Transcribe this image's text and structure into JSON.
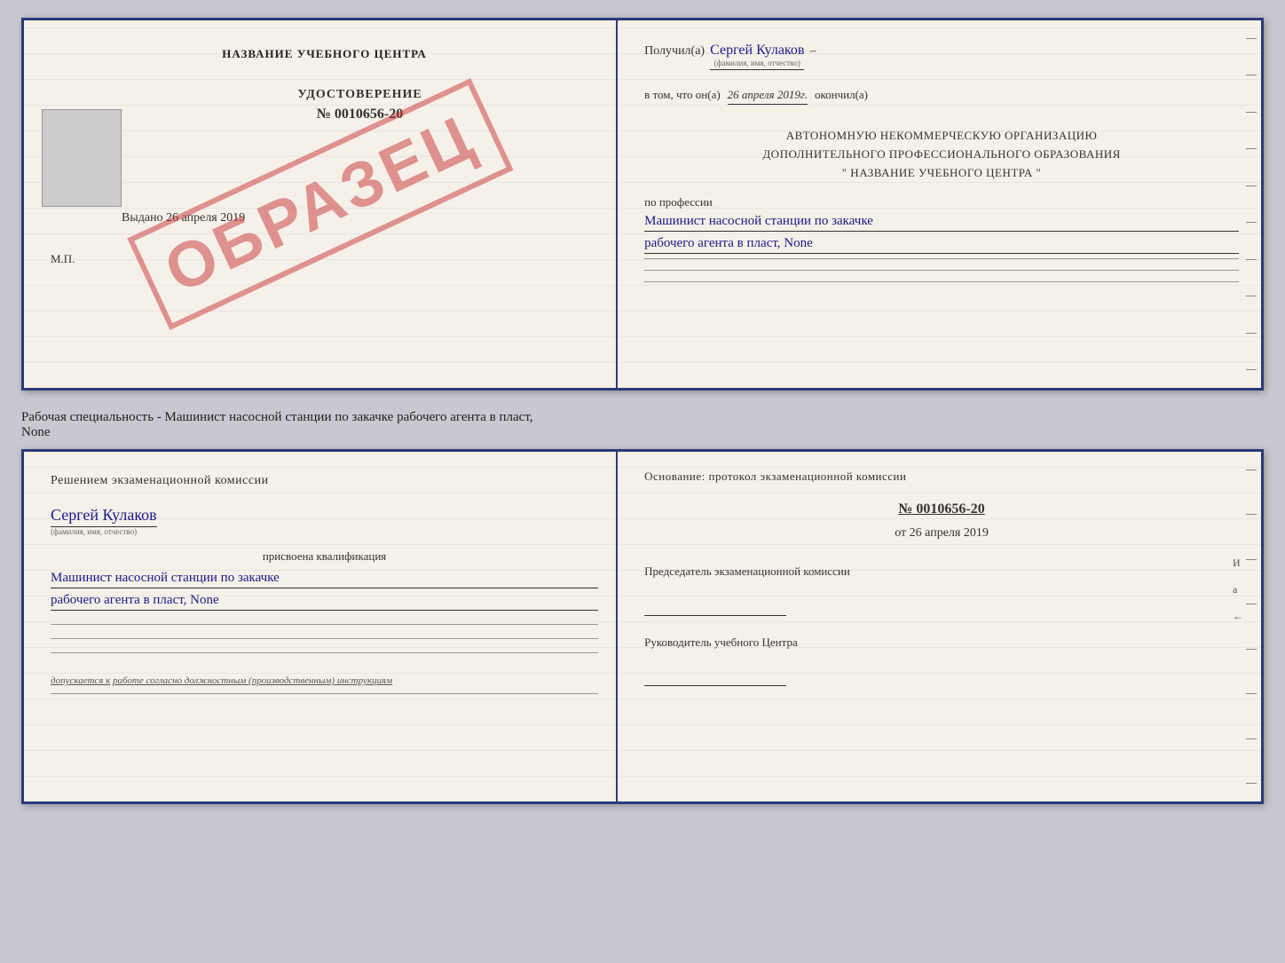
{
  "top_doc": {
    "left": {
      "center_title": "НАЗВАНИЕ УЧЕБНОГО ЦЕНТРА",
      "photo_alt": "фото",
      "stamp_text": "ОБРАЗЕЦ",
      "udostoverenie_label": "УДОСТОВЕРЕНИЕ",
      "doc_number": "№ 0010656-20",
      "vydano_label": "Выдано",
      "vydano_date": "26 апреля 2019",
      "mp_label": "М.П."
    },
    "right": {
      "poluchil_label": "Получил(а)",
      "poluchil_name": "Сергей Кулаков",
      "name_hint": "(фамилия, имя, отчество)",
      "dash": "–",
      "vtom_label": "в том, что он(а)",
      "vtom_date": "26 апреля 2019г.",
      "okonchil_label": "окончил(а)",
      "org_line1": "АВТОНОМНУЮ НЕКОММЕРЧЕСКУЮ ОРГАНИЗАЦИЮ",
      "org_line2": "ДОПОЛНИТЕЛЬНОГО ПРОФЕССИОНАЛЬНОГО ОБРАЗОВАНИЯ",
      "org_line3": "\" НАЗВАНИЕ УЧЕБНОГО ЦЕНТРА \"",
      "po_professii": "по профессии",
      "profession_line1": "Машинист насосной станции по закачке",
      "profession_line2": "рабочего агента в пласт, None"
    }
  },
  "middle": {
    "text": "Рабочая специальность - Машинист насосной станции по закачке рабочего агента в пласт,",
    "text2": "None"
  },
  "bottom_doc": {
    "left": {
      "resheniem_text": "Решением экзаменационной комиссии",
      "name": "Сергей Кулаков",
      "name_hint": "(фамилия, имя, отчество)",
      "prisvoena": "присвоена квалификация",
      "qualification_line1": "Машинист насосной станции по закачке",
      "qualification_line2": "рабочего агента в пласт, None",
      "dopuskaetsya_label": "допускается к",
      "dopuskaetsya_text": "работе согласно должностным (производственным) инструкциям"
    },
    "right": {
      "osnovanie_label": "Основание: протокол экзаменационной комиссии",
      "protocol_number": "№ 0010656-20",
      "ot_label": "от",
      "ot_date": "26 апреля 2019",
      "predsedatel_label": "Председатель экзаменационной комиссии",
      "rukovoditel_label": "Руководитель учебного Центра"
    }
  }
}
